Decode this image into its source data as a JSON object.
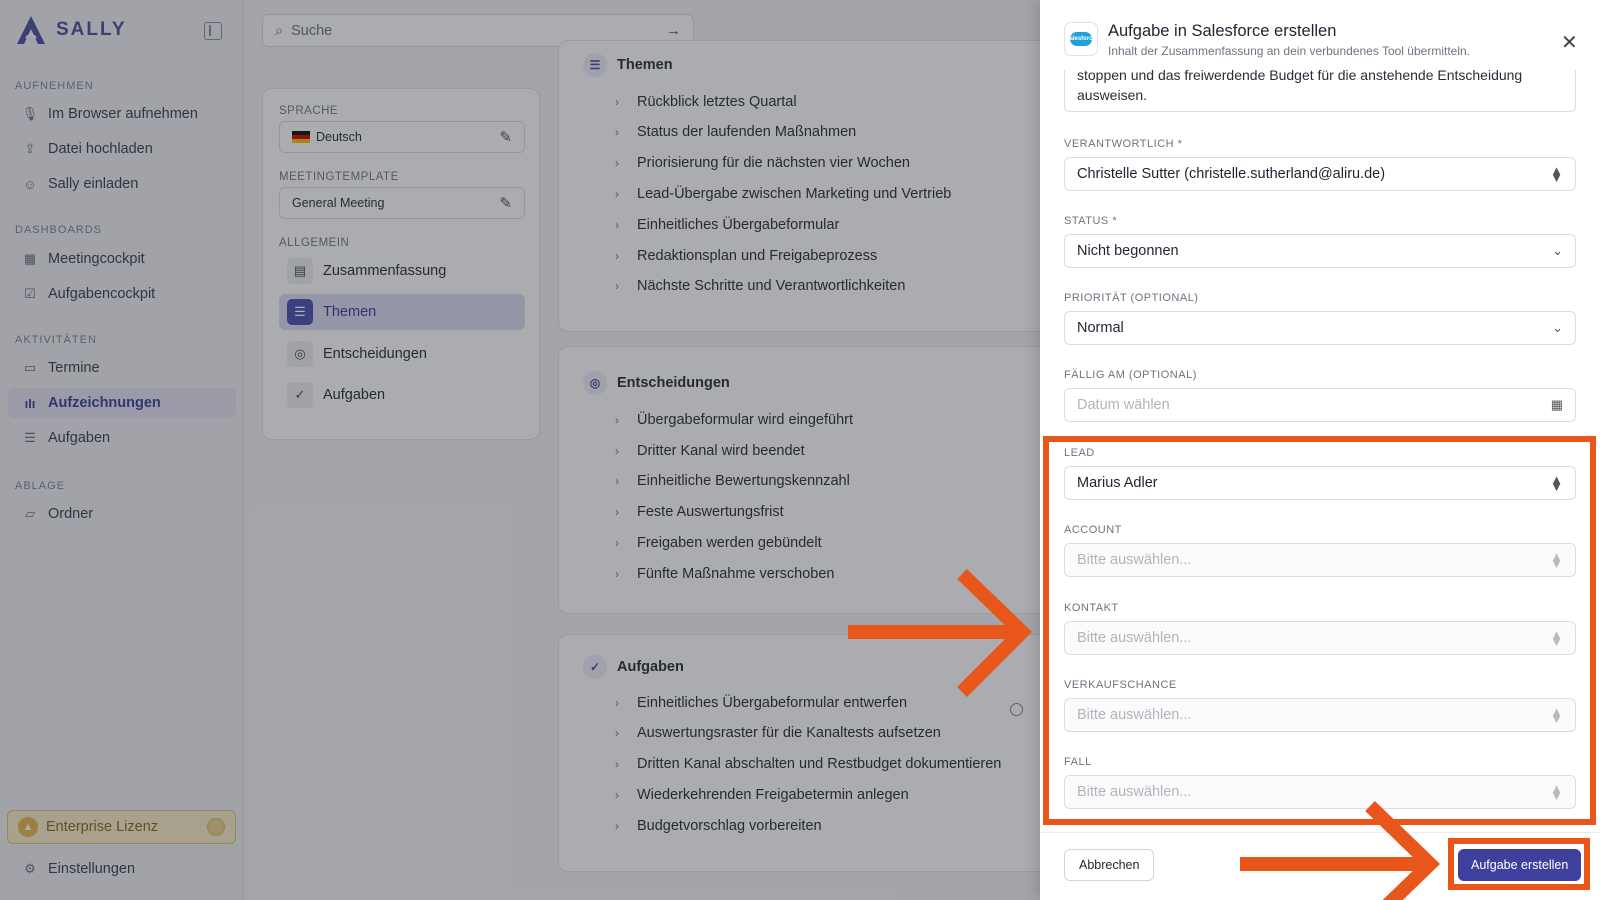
{
  "app": {
    "name": "SALLY"
  },
  "sidebar": {
    "sections": [
      {
        "heading": "AUFNEHMEN",
        "items": [
          {
            "label": "Im Browser aufnehmen",
            "icon": "microphone-icon"
          },
          {
            "label": "Datei hochladen",
            "icon": "upload-icon"
          },
          {
            "label": "Sally einladen",
            "icon": "user-plus-icon"
          }
        ]
      },
      {
        "heading": "DASHBOARDS",
        "items": [
          {
            "label": "Meetingcockpit",
            "icon": "grid-icon"
          },
          {
            "label": "Aufgabencockpit",
            "icon": "checkbox-icon"
          }
        ]
      },
      {
        "heading": "AKTIVITÄTEN",
        "items": [
          {
            "label": "Termine",
            "icon": "calendar-icon"
          },
          {
            "label": "Aufzeichnungen",
            "icon": "waveform-icon",
            "active": true
          },
          {
            "label": "Aufgaben",
            "icon": "checklist-icon"
          }
        ]
      },
      {
        "heading": "ABLAGE",
        "items": [
          {
            "label": "Ordner",
            "icon": "folder-icon"
          }
        ]
      }
    ],
    "license": "Enterprise Lizenz",
    "settings": "Einstellungen"
  },
  "search": {
    "placeholder": "Suche"
  },
  "settings_panel": {
    "language_label": "SPRACHE",
    "language_value": "Deutsch",
    "template_label": "MEETINGTEMPLATE",
    "template_value": "General Meeting",
    "general_label": "ALLGEMEIN",
    "menu": [
      "Zusammenfassung",
      "Themen",
      "Entscheidungen",
      "Aufgaben"
    ]
  },
  "themes_card": {
    "title": "Themen",
    "items": [
      "Rückblick letztes Quartal",
      "Status der laufenden Maßnahmen",
      "Priorisierung für die nächsten vier Wochen",
      "Lead-Übergabe zwischen Marketing und Vertrieb",
      "Einheitliches Übergabeformular",
      "Redaktionsplan und Freigabeprozess",
      "Nächste Schritte und Verantwortlichkeiten"
    ]
  },
  "decisions_card": {
    "title": "Entscheidungen",
    "items": [
      "Übergabeformular wird eingeführt",
      "Dritter Kanal wird beendet",
      "Einheitliche Bewertungskennzahl",
      "Feste Auswertungsfrist",
      "Freigaben werden gebündelt",
      "Fünfte Maßnahme verschoben"
    ]
  },
  "tasks_card": {
    "title": "Aufgaben",
    "items": [
      "Einheitliches Übergabeformular entwerfen",
      "Auswertungsraster für die Kanaltests aufsetzen",
      "Dritten Kanal abschalten und Restbudget dokumentieren",
      "Wiederkehrenden Freigabetermin anlegen",
      "Budgetvorschlag vorbereiten"
    ]
  },
  "drawer": {
    "title": "Aufgabe in Salesforce erstellen",
    "subtitle": "Inhalt der Zusammenfassung an dein verbundenes Tool übermitteln.",
    "description_tail_line1": "stoppen und das freiwerdende Budget für die anstehende Entscheidung",
    "description_tail_line2": "ausweisen.",
    "fields": {
      "owner_label": "VERANTWORTLICH *",
      "owner_value": "Christelle Sutter (christelle.sutherland@aliru.de)",
      "status_label": "STATUS *",
      "status_value": "Nicht begonnen",
      "priority_label": "PRIORITÄT (OPTIONAL)",
      "priority_value": "Normal",
      "due_label": "FÄLLIG AM (OPTIONAL)",
      "due_placeholder": "Datum wählen",
      "lead_label": "LEAD",
      "lead_value": "Marius Adler",
      "account_label": "ACCOUNT",
      "account_placeholder": "Bitte auswählen...",
      "contact_label": "KONTAKT",
      "contact_placeholder": "Bitte auswählen...",
      "opportunity_label": "VERKAUFSCHANCE",
      "opportunity_placeholder": "Bitte auswählen...",
      "case_label": "FALL",
      "case_placeholder": "Bitte auswählen..."
    },
    "cancel_label": "Abbrechen",
    "submit_label": "Aufgabe erstellen",
    "logo_text": "salesforce"
  },
  "colors": {
    "accent": "#3f3f9e",
    "annotation": "#e9561b",
    "license": "#fbeec8"
  }
}
